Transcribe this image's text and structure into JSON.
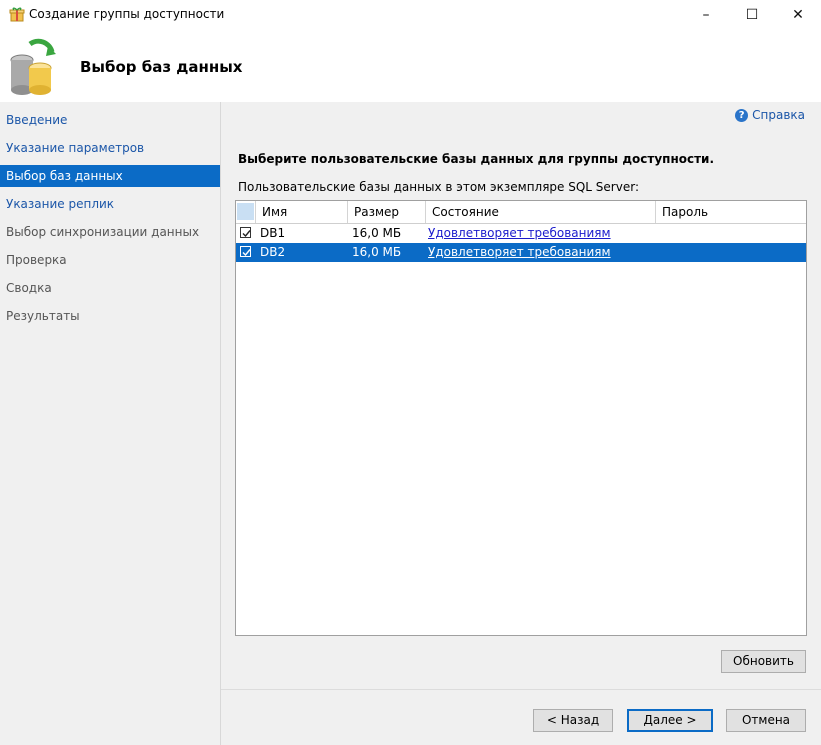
{
  "window": {
    "title": "Создание группы доступности",
    "minimize": "–",
    "maximize": "☐",
    "close": "✕"
  },
  "header": {
    "title": "Выбор баз данных"
  },
  "sidebar": {
    "items": [
      {
        "label": "Введение"
      },
      {
        "label": "Указание параметров"
      },
      {
        "label": "Выбор баз данных"
      },
      {
        "label": "Указание реплик"
      },
      {
        "label": "Выбор синхронизации данных"
      },
      {
        "label": "Проверка"
      },
      {
        "label": "Сводка"
      },
      {
        "label": "Результаты"
      }
    ]
  },
  "main": {
    "help": "Справка",
    "instruction": "Выберите пользовательские базы данных для группы доступности.",
    "list_label": "Пользовательские базы данных в этом экземпляре SQL Server:",
    "columns": [
      "Имя",
      "Размер",
      "Состояние",
      "Пароль"
    ],
    "rows": [
      {
        "name": "DB1",
        "size": "16,0 МБ",
        "status": "Удовлетворяет требованиям",
        "password": "",
        "checked": true
      },
      {
        "name": "DB2",
        "size": "16,0 МБ",
        "status": "Удовлетворяет требованиям",
        "password": "",
        "checked": true
      }
    ],
    "refresh_button": "Обновить"
  },
  "footer": {
    "back_button": "< Назад",
    "next_button": "Далее >",
    "cancel_button": "Отмена"
  },
  "colors": {
    "accent": "#0b6bc6",
    "link": "#1b56a8",
    "panel": "#f0f0f0"
  }
}
